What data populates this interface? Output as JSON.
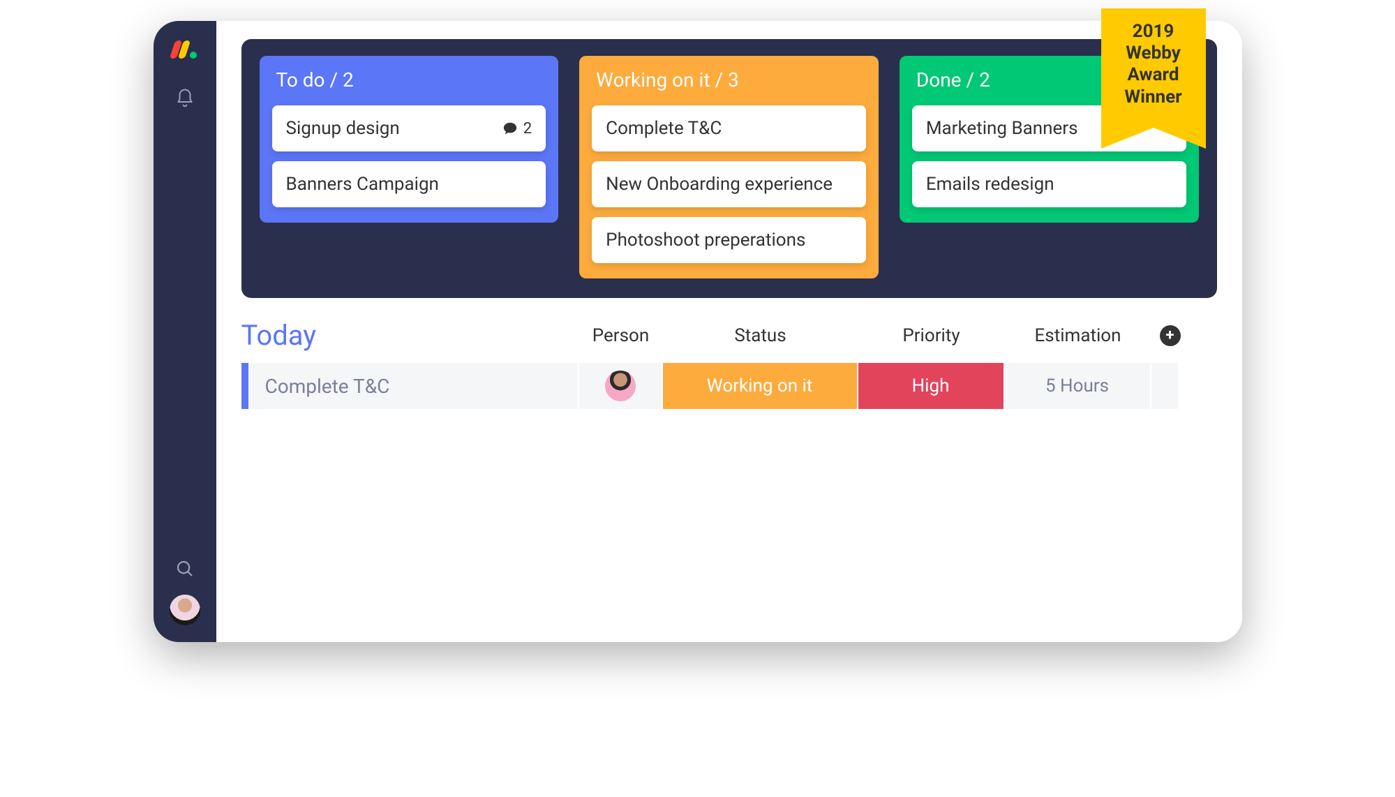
{
  "ribbon": {
    "line1": "2019",
    "line2": "Webby",
    "line3": "Award",
    "line4": "Winner"
  },
  "kanban": {
    "columns": [
      {
        "title": "To do / 2",
        "color": "blue",
        "cards": [
          {
            "title": "Signup design",
            "comments": "2"
          },
          {
            "title": "Banners Campaign"
          }
        ]
      },
      {
        "title": "Working on it / 3",
        "color": "orange",
        "cards": [
          {
            "title": "Complete T&C"
          },
          {
            "title": "New Onboarding experience"
          },
          {
            "title": "Photoshoot preperations"
          }
        ]
      },
      {
        "title": "Done / 2",
        "color": "green",
        "cards": [
          {
            "title": "Marketing Banners"
          },
          {
            "title": "Emails redesign"
          }
        ]
      }
    ]
  },
  "today": {
    "heading": "Today",
    "columns": {
      "person": "Person",
      "status": "Status",
      "priority": "Priority",
      "estimation": "Estimation"
    },
    "row": {
      "name": "Complete T&C",
      "status": "Working on it",
      "priority": "High",
      "estimation": "5 Hours"
    }
  }
}
